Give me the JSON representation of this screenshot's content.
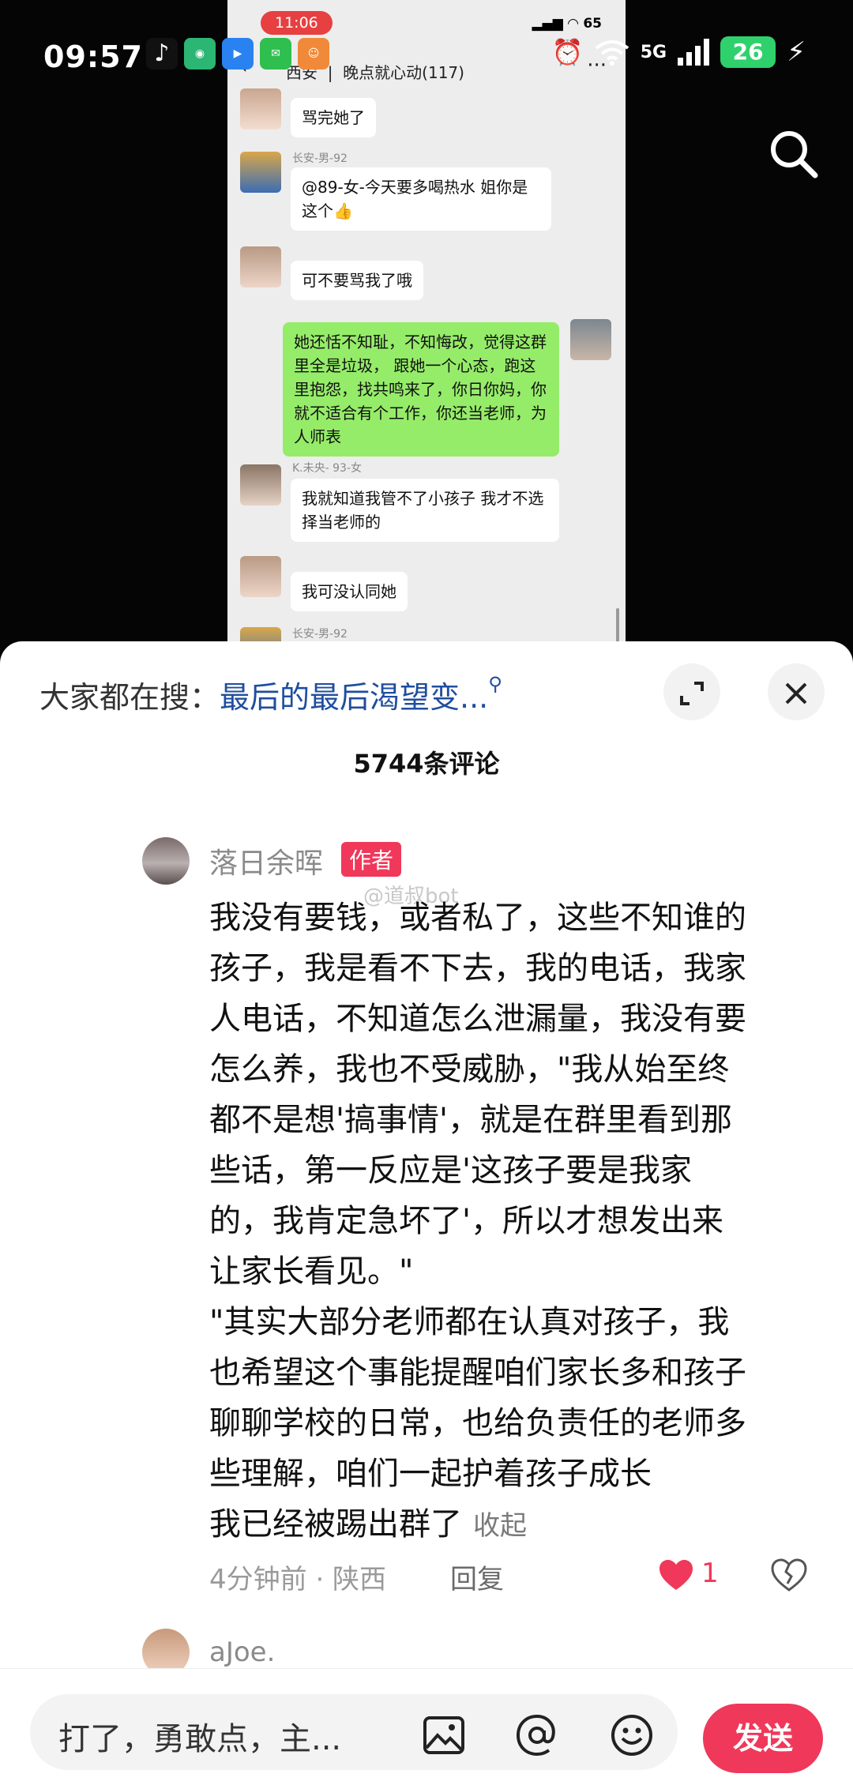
{
  "status_bar": {
    "time": "09:57",
    "network": "5G",
    "battery": "26"
  },
  "video_screenshot": {
    "phone_time": "11:06",
    "phone_battery": "65",
    "chat_location": "西安",
    "chat_title": "晚点就心动(117)",
    "messages": [
      {
        "nick": "",
        "text": "骂完她了",
        "side": "left"
      },
      {
        "nick": "长安-男-92",
        "text": "@89-女-今天要多喝热水 姐你是这个👍",
        "side": "left"
      },
      {
        "nick": "",
        "text": "可不要骂我了哦",
        "side": "left"
      },
      {
        "nick": "",
        "text": "她还恬不知耻，不知悔改，觉得这群里全是垃圾， 跟她一个心态，跑这里抱怨，找共鸣来了，你日你妈，你就不适合有个工作，你还当老师，为人师表",
        "side": "right"
      },
      {
        "nick": "K.未央- 93-女",
        "text": "我就知道我管不了小孩子 我才不选择当老师的",
        "side": "left"
      },
      {
        "nick": "",
        "text": "我可没认同她",
        "side": "left"
      },
      {
        "nick": "长安-男-92",
        "text": "",
        "side": "left"
      }
    ]
  },
  "comments_panel": {
    "hot_search_label": "大家都在搜：",
    "hot_search_keyword": "最后的最后渴望变...",
    "comment_count": "5744条评论",
    "comment": {
      "author": "落日余晖",
      "badge": "作者",
      "watermark": "@道叔bot",
      "text": "我没有要钱，或者私了，这些不知谁的\n孩子，我是看不下去，我的电话，我家\n人电话，不知道怎么泄漏量，我没有要\n怎么养，我也不受威胁，\"我从始至终\n都不是想'搞事情'，就是在群里看到那\n些话，第一反应是'这孩子要是我家\n的，我肯定急坏了'，所以才想发出来\n让家长看见。\"\n\"其实大部分老师都在认真对孩子，我\n也希望这个事能提醒咱们家长多和孩子\n聊聊学校的日常，也给负责任的老师多\n些理解，咱们一起护着孩子成长\n我已经被踢出群了",
      "collapse_label": "收起",
      "time_location": "4分钟前 · 陕西",
      "reply_label": "回复",
      "like_count": "1"
    },
    "next_comment": {
      "author": "aJoe."
    },
    "input": {
      "placeholder": "打了，勇敢点，主...",
      "send_label": "发送"
    }
  },
  "colors": {
    "accent": "#f0385a",
    "link": "#1f4e9e",
    "chat_green": "#95ec69",
    "chat_bg": "#ededed"
  }
}
